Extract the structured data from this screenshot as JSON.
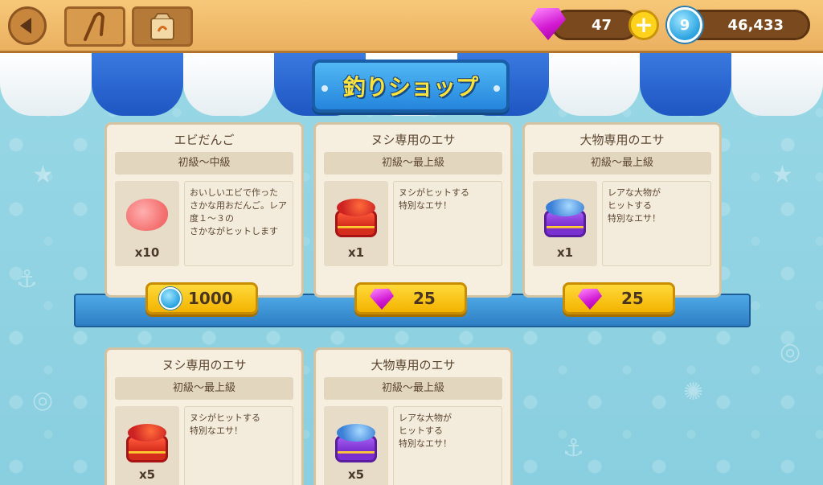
{
  "header": {
    "back_icon": "back-arrow-icon",
    "rod_icon": "fishing-rod-icon",
    "bait_bag_icon": "bait-bag-icon",
    "gems_value": "47",
    "coins_value": "46,433",
    "coin_glyph": "9"
  },
  "shop": {
    "title": "釣りショップ"
  },
  "items": [
    {
      "name": "エビだんご",
      "level": "初級〜中級",
      "description": "おいしいエビで作った\nさかな用おだんご。レア度１〜３の\nさかながヒットします",
      "quantity": "x10",
      "price": "1000",
      "currency": "coin",
      "icon": "shrimp-dumpling-icon"
    },
    {
      "name": "ヌシ専用のエサ",
      "level": "初級〜最上級",
      "description": "ヌシがヒットする\n特別なエサ！",
      "quantity": "x1",
      "price": "25",
      "currency": "gem",
      "icon": "boss-bait-can-icon"
    },
    {
      "name": "大物専用のエサ",
      "level": "初級〜最上級",
      "description": "レアな大物が\nヒットする\n特別なエサ！",
      "quantity": "x1",
      "price": "25",
      "currency": "gem",
      "icon": "big-fish-bait-can-icon"
    },
    {
      "name": "ヌシ専用のエサ",
      "level": "初級〜最上級",
      "description": "ヌシがヒットする\n特別なエサ！",
      "quantity": "x5",
      "icon": "boss-bait-can-icon"
    },
    {
      "name": "大物専用のエサ",
      "level": "初級〜最上級",
      "description": "レアな大物が\nヒットする\n特別なエサ！",
      "quantity": "x5",
      "icon": "big-fish-bait-can-icon"
    }
  ]
}
